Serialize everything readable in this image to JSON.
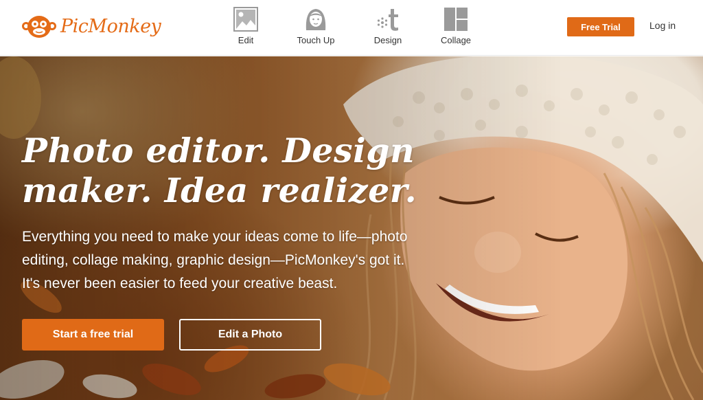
{
  "header": {
    "logo_text": "PicMonkey",
    "nav": [
      {
        "label": "Edit",
        "icon": "image-icon"
      },
      {
        "label": "Touch Up",
        "icon": "face-icon"
      },
      {
        "label": "Design",
        "icon": "design-icon"
      },
      {
        "label": "Collage",
        "icon": "collage-icon"
      }
    ],
    "free_trial_label": "Free Trial",
    "login_label": "Log in"
  },
  "hero": {
    "title_line1": "Photo editor. Design",
    "title_line2": "maker. Idea realizer.",
    "subtitle_line1": "Everything you need to make your ideas come to life—photo",
    "subtitle_line2": "editing, collage making, graphic design—PicMonkey's got it.",
    "subtitle_line3": "It's never been easier to feed your creative beast.",
    "primary_button_label": "Start a free trial",
    "secondary_button_label": "Edit a Photo"
  },
  "colors": {
    "brand_orange": "#e06a17",
    "nav_icon_gray": "#9a9a9a",
    "text_dark": "#333333"
  }
}
